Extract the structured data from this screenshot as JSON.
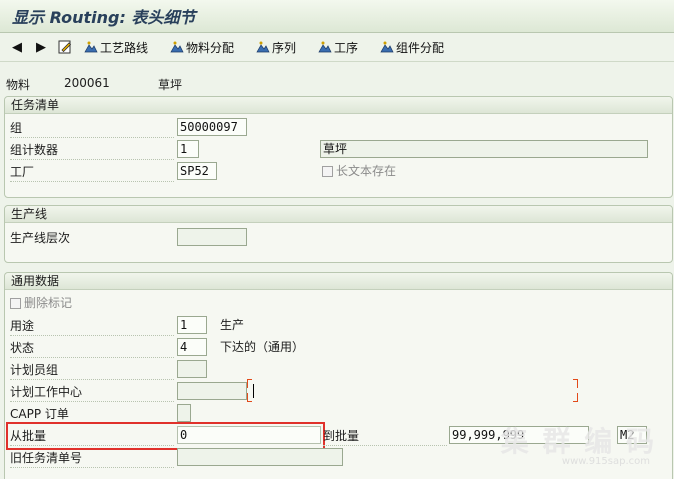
{
  "window": {
    "title": "显示 Routing: 表头细节"
  },
  "toolbar": {
    "back_icon": "arrow-left-icon",
    "forward_icon": "arrow-right-icon",
    "edit_icon": "pencil-icon",
    "buttons": [
      {
        "label": "工艺路线",
        "icon": "mountain-icon"
      },
      {
        "label": "物料分配",
        "icon": "mountain-icon"
      },
      {
        "label": "序列",
        "icon": "mountain-icon"
      },
      {
        "label": "工序",
        "icon": "mountain-icon"
      },
      {
        "label": "组件分配",
        "icon": "mountain-icon"
      }
    ]
  },
  "header": {
    "material_label": "物料",
    "material_no": "200061",
    "material_desc": "草坪"
  },
  "task_list": {
    "title": "任务清单",
    "group_label": "组",
    "group_value": "50000097",
    "counter_label": "组计数器",
    "counter_value": "1",
    "counter_desc": "草坪",
    "plant_label": "工厂",
    "plant_value": "SP52",
    "long_text_label": "长文本存在"
  },
  "production_line": {
    "title": "生产线",
    "level_label": "生产线层次",
    "level_value": ""
  },
  "general": {
    "title": "通用数据",
    "delete_flag_label": "删除标记",
    "usage_label": "用途",
    "usage_value": "1",
    "usage_text": "生产",
    "status_label": "状态",
    "status_value": "4",
    "status_text": "下达的（通用）",
    "planner_group_label": "计划员组",
    "planner_group_value": "",
    "work_center_label": "计划工作中心",
    "work_center_value": "",
    "capp_label": "CAPP 订单",
    "capp_value": "",
    "from_lot_label": "从批量",
    "from_lot_value": "0",
    "to_lot_label": "到批量",
    "to_lot_value": "99,999,999",
    "unit_value": "M2",
    "old_task_list_label": "旧任务清单号",
    "old_task_list_value": ""
  },
  "watermark": {
    "text": "集 群 编 码",
    "url": "www.915sap.com"
  },
  "colors": {
    "highlight_box": "#e0312b",
    "title_text": "#29405b",
    "background": "#eef3ea"
  }
}
